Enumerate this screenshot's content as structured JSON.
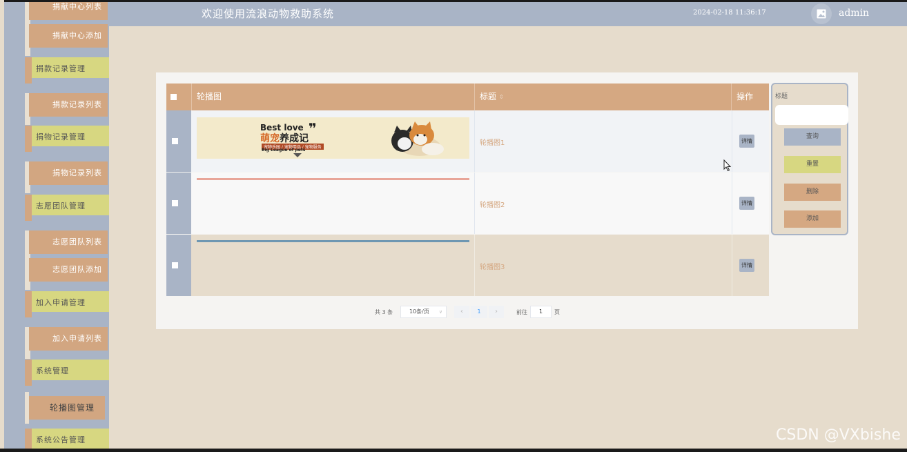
{
  "header": {
    "title": "欢迎使用流浪动物救助系统",
    "datetime": "2024-02-18 11:36:17",
    "username": "admin",
    "avatar_icon": "image-icon"
  },
  "sidebar": {
    "items": [
      {
        "label": "捐献中心列表",
        "type": "sub"
      },
      {
        "label": "捐献中心添加",
        "type": "sub"
      },
      {
        "label": "捐款记录管理",
        "type": "group"
      },
      {
        "label": "捐款记录列表",
        "type": "sub"
      },
      {
        "label": "捐物记录管理",
        "type": "group"
      },
      {
        "label": "捐物记录列表",
        "type": "sub"
      },
      {
        "label": "志愿团队管理",
        "type": "group"
      },
      {
        "label": "志愿团队列表",
        "type": "sub"
      },
      {
        "label": "志愿团队添加",
        "type": "sub"
      },
      {
        "label": "加入申请管理",
        "type": "group"
      },
      {
        "label": "加入申请列表",
        "type": "sub"
      },
      {
        "label": "系统管理",
        "type": "group"
      },
      {
        "label": "轮播图管理",
        "type": "active"
      },
      {
        "label": "系统公告管理",
        "type": "group"
      }
    ]
  },
  "table": {
    "columns": {
      "image": "轮播图",
      "title": "标题",
      "sort_icon": "sort-icon",
      "action": "操作"
    },
    "rows": [
      {
        "title": "轮播图1",
        "action": "详情"
      },
      {
        "title": "轮播图2",
        "action": "详情"
      },
      {
        "title": "轮播图3",
        "action": "详情"
      }
    ],
    "banner1": {
      "line1": "Best love",
      "line2a": "萌宠",
      "line2b": "养成记",
      "line3": "宠物乐园 / 宠物用品 / 宠物服务",
      "line4": "Big League of pets"
    }
  },
  "pagination": {
    "total": "共 3 条",
    "page_size": "10条/页",
    "current_page": "1",
    "goto_label": "前往",
    "goto_value": "1",
    "page_unit": "页"
  },
  "filter_panel": {
    "label": "标题",
    "input_value": "",
    "search": "查询",
    "reset": "重置",
    "delete": "删除",
    "add": "添加"
  },
  "watermark": "CSDN @VXbishe",
  "colors": {
    "blue_gray": "#a9b4c6",
    "tan": "#d5a882",
    "khaki": "#d7d781",
    "beige": "#e6dccc"
  }
}
